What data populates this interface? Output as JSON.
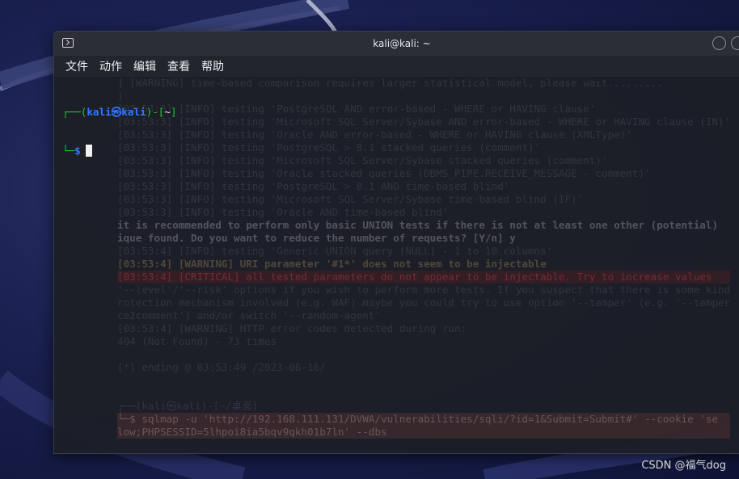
{
  "window": {
    "title": "kali@kali: ~"
  },
  "menubar": {
    "items": [
      "文件",
      "动作",
      "编辑",
      "查看",
      "帮助"
    ]
  },
  "prompt": {
    "open": "┌──(",
    "user": "kali",
    "skull": "㉿",
    "host": "kali",
    "mid": ")-[",
    "dir": "~",
    "close": "]",
    "line2_prefix": "└─",
    "symbol": "$"
  },
  "background_ghost": [
    {
      "t": "] [WARNING] time-based comparison requires larger statistical model, please wait.........",
      "s": ""
    },
    {
      "t": ")",
      "s": ""
    },
    {
      "t": "[03:53:3] [INFO] testing 'PostgreSQL AND error-based - WHERE or HAVING clause'",
      "s": ""
    },
    {
      "t": "[03:53:3] [INFO] testing 'Microsoft SQL Server/Sybase AND error-based - WHERE or HAVING clause (IN)'",
      "s": ""
    },
    {
      "t": "[03:53:3] [INFO] testing 'Oracle AND error-based - WHERE or HAVING clause (XMLType)'",
      "s": ""
    },
    {
      "t": "[03:53:3] [INFO] testing 'PostgreSQL > 8.1 stacked queries (comment)'",
      "s": ""
    },
    {
      "t": "[03:53:3] [INFO] testing 'Microsoft SQL Server/Sybase stacked queries (comment)'",
      "s": ""
    },
    {
      "t": "[03:53:3] [INFO] testing 'Oracle stacked queries (DBMS_PIPE.RECEIVE_MESSAGE - comment)'",
      "s": ""
    },
    {
      "t": "[03:53:3] [INFO] testing 'PostgreSQL > 8.1 AND time-based blind'",
      "s": ""
    },
    {
      "t": "[03:53:3] [INFO] testing 'Microsoft SQL Server/Sybase time-based blind (IF)'",
      "s": ""
    },
    {
      "t": "[03:53:3] [INFO] testing 'Oracle AND time-based blind'",
      "s": ""
    },
    {
      "t": "it is recommended to perform only basic UNION tests if there is not at least one other (potential)",
      "s": "bold"
    },
    {
      "t": "ique found. Do you want to reduce the number of requests? [Y/n] y",
      "s": "bold"
    },
    {
      "t": "[03:53:4] [INFO] testing 'Generic UNION query (NULL) - 1 to 10 columns'",
      "s": ""
    },
    {
      "t": "[03:53:4] [WARNING] URI parameter '#1*' does not seem to be injectable",
      "s": "warn"
    },
    {
      "t": "[03:53:4] [CRITICAL] all tested parameters do not appear to be injectable. Try to increase values",
      "s": "crit"
    },
    {
      "t": "'--level'/'--risk' options if you wish to perform more tests. If you suspect that there is some kind",
      "s": ""
    },
    {
      "t": "rotection mechanism involved (e.g. WAF) maybe you could try to use option '--tamper' (e.g. '--tamper",
      "s": ""
    },
    {
      "t": "ce2comment') and/or switch '--random-agent'",
      "s": ""
    },
    {
      "t": "[03:53:4] [WARNING] HTTP error codes detected during run:",
      "s": ""
    },
    {
      "t": "404 (Not Found) - 73 times",
      "s": ""
    },
    {
      "t": "",
      "s": ""
    },
    {
      "t": "[*] ending @ 03:53:49 /2023-06-16/",
      "s": ""
    },
    {
      "t": "",
      "s": ""
    },
    {
      "t": "",
      "s": ""
    },
    {
      "t": "┌──(kali㉿kali)-[~/桌面]",
      "s": ""
    },
    {
      "t": "└─$ sqlmap -u 'http://192.168.111.131/DVWA/vulnerabilities/sqli/?id=1&Submit=Submit#' --cookie 'se",
      "s": "hl"
    },
    {
      "t": "low;PHPSESSID=5lhpoi8ia5bqv9qkh01b7ln' --dbs",
      "s": "hl"
    }
  ],
  "watermark": "CSDN @福气dog"
}
